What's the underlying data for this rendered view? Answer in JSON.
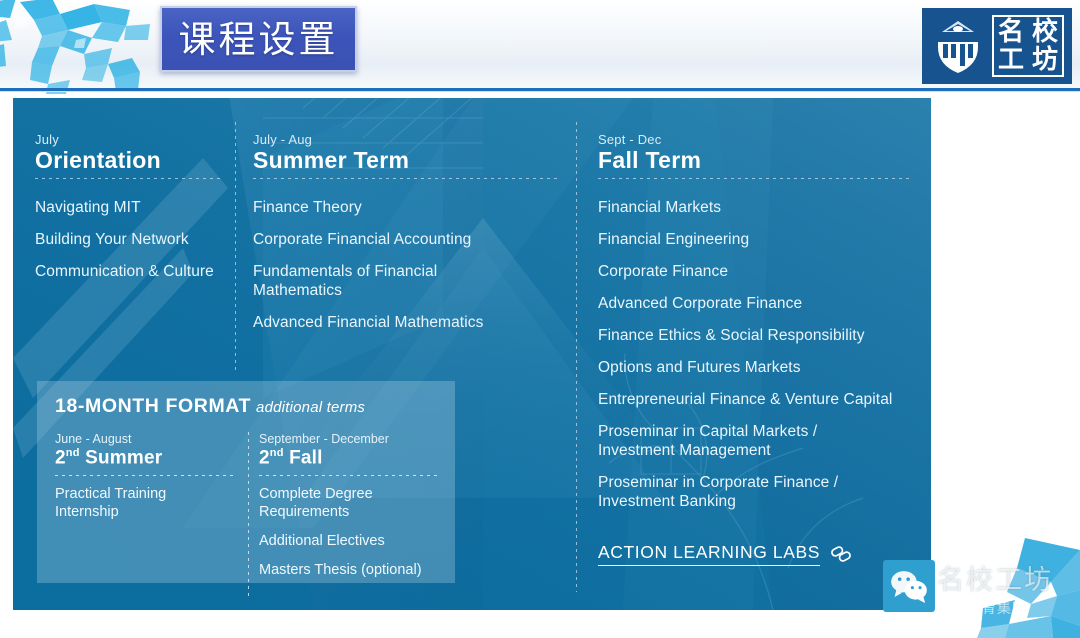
{
  "header": {
    "title": "课程设置",
    "brand": {
      "mark_icon": "graduation-pillar-icon",
      "name_chars": [
        "名",
        "校",
        "工",
        "坊"
      ]
    },
    "worldmap_icon": "world-map-icon"
  },
  "columns": [
    {
      "range": "July",
      "term": "Orientation",
      "items": [
        "Navigating MIT",
        "Building Your Network",
        "Communication & Culture"
      ]
    },
    {
      "range": "July - Aug",
      "term": "Summer Term",
      "items": [
        "Finance Theory",
        "Corporate Financial Accounting",
        "Fundamentals of Financial Mathematics",
        "Advanced Financial Mathematics"
      ]
    },
    {
      "range": "Sept - Dec",
      "term": "Fall Term",
      "items": [
        "Financial Markets",
        "Financial Engineering",
        "Corporate Finance",
        "Advanced Corporate Finance",
        "Finance Ethics & Social Responsibility",
        "Options and Futures Markets",
        "Entrepreneurial Finance & Venture Capital",
        "Proseminar in Capital Markets / Investment Management",
        "Proseminar in Corporate Finance / Investment Banking"
      ]
    }
  ],
  "action_link": {
    "label": "ACTION LEARNING LABS",
    "icon": "chain-link-icon"
  },
  "format_panel": {
    "title": "18-MONTH FORMAT",
    "subtitle": "additional terms",
    "columns": [
      {
        "range": "June - August",
        "term_ordinal": "2",
        "term_suffix": "nd",
        "term_name": "Summer",
        "items": [
          "Practical Training Internship"
        ]
      },
      {
        "range": "September - December",
        "term_ordinal": "2",
        "term_suffix": "nd",
        "term_name": "Fall",
        "items": [
          "Complete Degree Requirements",
          "Additional Electives",
          "Masters Thesis (optional)"
        ]
      }
    ]
  },
  "watermark": {
    "icon": "wechat-icon",
    "main": "名校工坊",
    "sub": "点睛教育集团"
  },
  "colors": {
    "panel_blue": "#0c6d9f",
    "title_box_blue": "#3c55bb",
    "brand_blue": "#17548f",
    "rule_blue": "#1d6fbe",
    "accent_cyan": "#29a8dd"
  }
}
